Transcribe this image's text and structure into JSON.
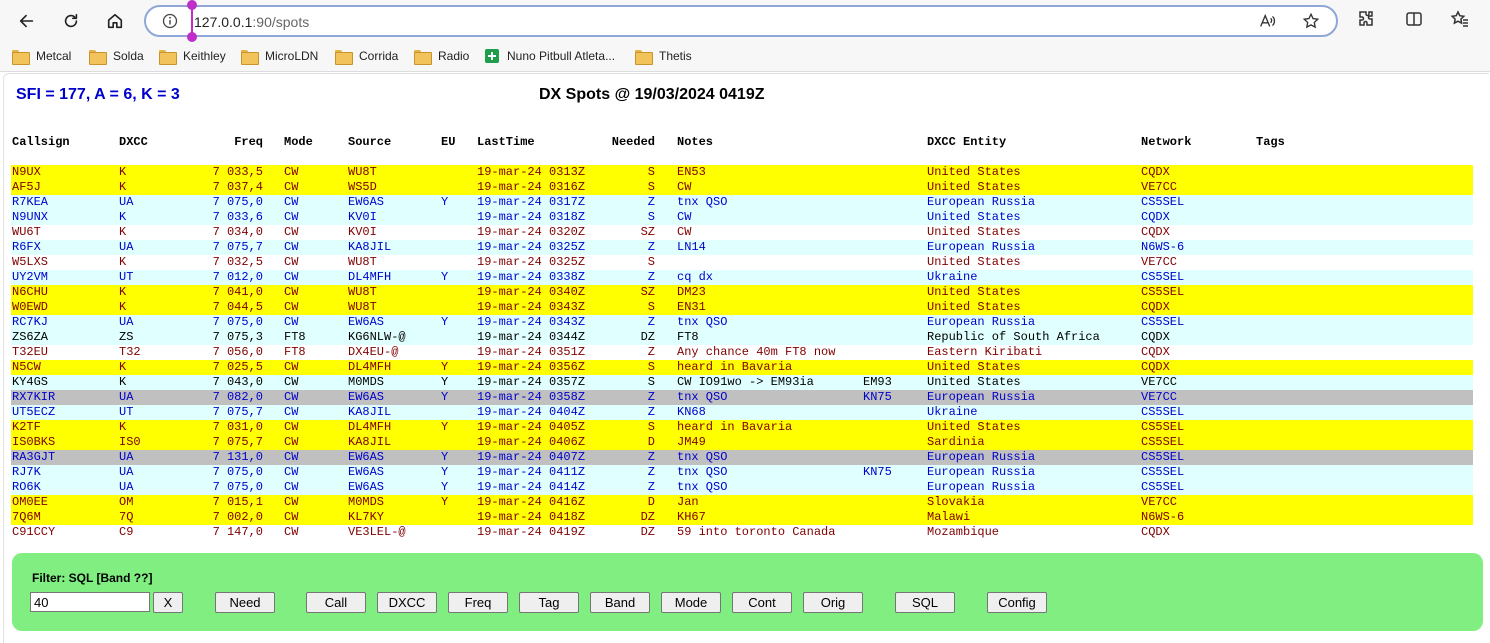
{
  "browser": {
    "url_host": "127.0.0.1",
    "url_rest": ":90/spots",
    "bookmarks": [
      "Metcal",
      "Solda",
      "Keithley",
      "MicroLDN",
      "Corrida",
      "Radio",
      "Nuno Pitbull Atleta...",
      "Thetis"
    ]
  },
  "page": {
    "sfi_text": "SFI = 177, A = 6, K = 3",
    "title": "DX Spots @ 19/03/2024 0419Z"
  },
  "colors": {
    "yellow": "#ffff00",
    "cyan": "#e0ffff",
    "grey": "#c0c0c0",
    "white": "#ffffff",
    "dark_red": "#800000",
    "blue": "#0000cc",
    "black": "#000000",
    "filter_green": "#80ee80"
  },
  "table": {
    "headers": {
      "call": "Callsign",
      "dxcc": "DXCC",
      "freq": "Freq",
      "mode": "Mode",
      "src": "Source",
      "eu": "EU",
      "time": "LastTime",
      "need": "Needed",
      "notes": "Notes",
      "ent": "DXCC Entity",
      "net": "Network",
      "tags": "Tags"
    },
    "rows": [
      {
        "bg": "yellow",
        "fg": "dark_red",
        "call": "N9UX",
        "dxcc": "K",
        "freq": "7 033,5",
        "mode": "CW",
        "src": "WU8T",
        "eu": "",
        "time": "19-mar-24 0313Z",
        "need": "S",
        "notes": "EN53",
        "grid": "",
        "ent": "United States",
        "net": "CQDX"
      },
      {
        "bg": "yellow",
        "fg": "dark_red",
        "call": "AF5J",
        "dxcc": "K",
        "freq": "7 037,4",
        "mode": "CW",
        "src": "WS5D",
        "eu": "",
        "time": "19-mar-24 0316Z",
        "need": "S",
        "notes": "CW",
        "grid": "",
        "ent": "United States",
        "net": "VE7CC"
      },
      {
        "bg": "cyan",
        "fg": "blue",
        "call": "R7KEA",
        "dxcc": "UA",
        "freq": "7 075,0",
        "mode": "CW",
        "src": "EW6AS",
        "eu": "Y",
        "time": "19-mar-24 0317Z",
        "need": "Z",
        "notes": "tnx QSO",
        "grid": "",
        "ent": "European Russia",
        "net": "CS5SEL"
      },
      {
        "bg": "cyan",
        "fg": "blue",
        "call": "N9UNX",
        "dxcc": "K",
        "freq": "7 033,6",
        "mode": "CW",
        "src": "KV0I",
        "eu": "",
        "time": "19-mar-24 0318Z",
        "need": "S",
        "notes": "CW",
        "grid": "",
        "ent": "United States",
        "net": "CQDX"
      },
      {
        "bg": "white",
        "fg": "dark_red",
        "call": "WU6T",
        "dxcc": "K",
        "freq": "7 034,0",
        "mode": "CW",
        "src": "KV0I",
        "eu": "",
        "time": "19-mar-24 0320Z",
        "need": "SZ",
        "notes": "CW",
        "grid": "",
        "ent": "United States",
        "net": "CQDX"
      },
      {
        "bg": "cyan",
        "fg": "blue",
        "call": "R6FX",
        "dxcc": "UA",
        "freq": "7 075,7",
        "mode": "CW",
        "src": "KA8JIL",
        "eu": "",
        "time": "19-mar-24 0325Z",
        "need": "Z",
        "notes": "LN14",
        "grid": "",
        "ent": "European Russia",
        "net": "N6WS-6"
      },
      {
        "bg": "white",
        "fg": "dark_red",
        "call": "W5LXS",
        "dxcc": "K",
        "freq": "7 032,5",
        "mode": "CW",
        "src": "WU8T",
        "eu": "",
        "time": "19-mar-24 0325Z",
        "need": "S",
        "notes": "",
        "grid": "",
        "ent": "United States",
        "net": "VE7CC"
      },
      {
        "bg": "cyan",
        "fg": "blue",
        "call": "UY2VM",
        "dxcc": "UT",
        "freq": "7 012,0",
        "mode": "CW",
        "src": "DL4MFH",
        "eu": "Y",
        "time": "19-mar-24 0338Z",
        "need": "Z",
        "notes": "cq dx",
        "grid": "",
        "ent": "Ukraine",
        "net": "CS5SEL"
      },
      {
        "bg": "yellow",
        "fg": "dark_red",
        "call": "N6CHU",
        "dxcc": "K",
        "freq": "7 041,0",
        "mode": "CW",
        "src": "WU8T",
        "eu": "",
        "time": "19-mar-24 0340Z",
        "need": "SZ",
        "notes": "DM23",
        "grid": "",
        "ent": "United States",
        "net": "CS5SEL"
      },
      {
        "bg": "yellow",
        "fg": "dark_red",
        "call": "W0EWD",
        "dxcc": "K",
        "freq": "7 044,5",
        "mode": "CW",
        "src": "WU8T",
        "eu": "",
        "time": "19-mar-24 0343Z",
        "need": "S",
        "notes": "EN31",
        "grid": "",
        "ent": "United States",
        "net": "CQDX"
      },
      {
        "bg": "cyan",
        "fg": "blue",
        "call": "RC7KJ",
        "dxcc": "UA",
        "freq": "7 075,0",
        "mode": "CW",
        "src": "EW6AS",
        "eu": "Y",
        "time": "19-mar-24 0343Z",
        "need": "Z",
        "notes": "tnx QSO",
        "grid": "",
        "ent": "European Russia",
        "net": "CS5SEL"
      },
      {
        "bg": "cyan",
        "fg": "black",
        "call": "ZS6ZA",
        "dxcc": "ZS",
        "freq": "7 075,3",
        "mode": "FT8",
        "src": "KG6NLW-@",
        "eu": "",
        "time": "19-mar-24 0344Z",
        "need": "DZ",
        "notes": "FT8",
        "grid": "",
        "ent": "Republic of South Africa",
        "net": "CQDX"
      },
      {
        "bg": "white",
        "fg": "dark_red",
        "call": "T32EU",
        "dxcc": "T32",
        "freq": "7 056,0",
        "mode": "FT8",
        "src": "DX4EU-@",
        "eu": "",
        "time": "19-mar-24 0351Z",
        "need": "Z",
        "notes": "Any chance 40m FT8 now",
        "grid": "",
        "ent": "Eastern Kiribati",
        "net": "CQDX"
      },
      {
        "bg": "yellow",
        "fg": "dark_red",
        "call": "N5CW",
        "dxcc": "K",
        "freq": "7 025,5",
        "mode": "CW",
        "src": "DL4MFH",
        "eu": "Y",
        "time": "19-mar-24 0356Z",
        "need": "S",
        "notes": "heard in Bavaria",
        "grid": "",
        "ent": "United States",
        "net": "CQDX"
      },
      {
        "bg": "cyan",
        "fg": "black",
        "call": "KY4GS",
        "dxcc": "K",
        "freq": "7 043,0",
        "mode": "CW",
        "src": "M0MDS",
        "eu": "Y",
        "time": "19-mar-24 0357Z",
        "need": "S",
        "notes": "CW IO91wo -> EM93ia",
        "grid": "EM93",
        "ent": "United States",
        "net": "VE7CC"
      },
      {
        "bg": "grey",
        "fg": "blue",
        "call": "RX7KIR",
        "dxcc": "UA",
        "freq": "7 082,0",
        "mode": "CW",
        "src": "EW6AS",
        "eu": "Y",
        "time": "19-mar-24 0358Z",
        "need": "Z",
        "notes": "tnx QSO",
        "grid": "KN75",
        "ent": "European Russia",
        "net": "VE7CC"
      },
      {
        "bg": "cyan",
        "fg": "blue",
        "call": "UT5ECZ",
        "dxcc": "UT",
        "freq": "7 075,7",
        "mode": "CW",
        "src": "KA8JIL",
        "eu": "",
        "time": "19-mar-24 0404Z",
        "need": "Z",
        "notes": "KN68",
        "grid": "",
        "ent": "Ukraine",
        "net": "CS5SEL"
      },
      {
        "bg": "yellow",
        "fg": "dark_red",
        "call": "K2TF",
        "dxcc": "K",
        "freq": "7 031,0",
        "mode": "CW",
        "src": "DL4MFH",
        "eu": "Y",
        "time": "19-mar-24 0405Z",
        "need": "S",
        "notes": "heard in Bavaria",
        "grid": "",
        "ent": "United States",
        "net": "CS5SEL"
      },
      {
        "bg": "yellow",
        "fg": "dark_red",
        "call": "IS0BKS",
        "dxcc": "IS0",
        "freq": "7 075,7",
        "mode": "CW",
        "src": "KA8JIL",
        "eu": "",
        "time": "19-mar-24 0406Z",
        "need": "D",
        "notes": "JM49",
        "grid": "",
        "ent": "Sardinia",
        "net": "CS5SEL"
      },
      {
        "bg": "grey",
        "fg": "blue",
        "call": "RA3GJT",
        "dxcc": "UA",
        "freq": "7 131,0",
        "mode": "CW",
        "src": "EW6AS",
        "eu": "Y",
        "time": "19-mar-24 0407Z",
        "need": "Z",
        "notes": "tnx QSO",
        "grid": "",
        "ent": "European Russia",
        "net": "CS5SEL"
      },
      {
        "bg": "cyan",
        "fg": "blue",
        "call": "RJ7K",
        "dxcc": "UA",
        "freq": "7 075,0",
        "mode": "CW",
        "src": "EW6AS",
        "eu": "Y",
        "time": "19-mar-24 0411Z",
        "need": "Z",
        "notes": "tnx QSO",
        "grid": "KN75",
        "ent": "European Russia",
        "net": "CS5SEL"
      },
      {
        "bg": "cyan",
        "fg": "blue",
        "call": "RO6K",
        "dxcc": "UA",
        "freq": "7 075,0",
        "mode": "CW",
        "src": "EW6AS",
        "eu": "Y",
        "time": "19-mar-24 0414Z",
        "need": "Z",
        "notes": "tnx QSO",
        "grid": "",
        "ent": "European Russia",
        "net": "CS5SEL"
      },
      {
        "bg": "yellow",
        "fg": "dark_red",
        "call": "OM0EE",
        "dxcc": "OM",
        "freq": "7 015,1",
        "mode": "CW",
        "src": "M0MDS",
        "eu": "Y",
        "time": "19-mar-24 0416Z",
        "need": "D",
        "notes": "Jan",
        "grid": "",
        "ent": "Slovakia",
        "net": "VE7CC"
      },
      {
        "bg": "yellow",
        "fg": "dark_red",
        "call": "7Q6M",
        "dxcc": "7Q",
        "freq": "7 002,0",
        "mode": "CW",
        "src": "KL7KY",
        "eu": "",
        "time": "19-mar-24 0418Z",
        "need": "DZ",
        "notes": "KH67",
        "grid": "",
        "ent": "Malawi",
        "net": "N6WS-6"
      },
      {
        "bg": "white",
        "fg": "dark_red",
        "call": "C91CCY",
        "dxcc": "C9",
        "freq": "7 147,0",
        "mode": "CW",
        "src": "VE3LEL-@",
        "eu": "",
        "time": "19-mar-24 0419Z",
        "need": "DZ",
        "notes": "59 into toronto Canada",
        "grid": "",
        "ent": "Mozambique",
        "net": "CQDX"
      }
    ]
  },
  "filter": {
    "label": "Filter: SQL [Band ??]",
    "input_value": "40",
    "buttons": [
      "X",
      "Need",
      "Call",
      "DXCC",
      "Freq",
      "Tag",
      "Band",
      "Mode",
      "Cont",
      "Orig",
      "SQL",
      "Config"
    ]
  }
}
